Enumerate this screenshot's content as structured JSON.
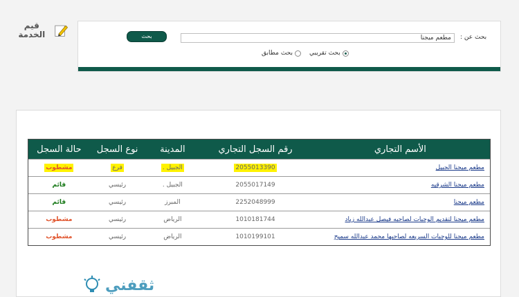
{
  "rating": {
    "label": "قيم الخدمة"
  },
  "search": {
    "button_label": "بحث",
    "search_by_label": "بحث عن :",
    "input_value": "مطعم ميجنا",
    "options": [
      {
        "label": "بحث تقريبي",
        "selected": true
      },
      {
        "label": "بحث مطابق",
        "selected": false
      }
    ]
  },
  "table": {
    "headers": {
      "name": "الأسم التجاري",
      "reg_no": "رقم السجل التجاري",
      "city": "المدينة",
      "type": "نوع السجل",
      "status": "حالة السجل"
    },
    "rows": [
      {
        "name": "مطعم ميجنا الجبيل",
        "reg_no": "2055013390",
        "city": "الجبيل .",
        "type": "فرع",
        "status": "مشطوب"
      },
      {
        "name": "مطعم ميجنا الشرقيه",
        "reg_no": "2055017149",
        "city": "الجبيل .",
        "type": "رئيسي",
        "status": "قائم"
      },
      {
        "name": "مطعم ميجنا",
        "reg_no": "2252048999",
        "city": "المبرز",
        "type": "رئيسي",
        "status": "قائم"
      },
      {
        "name": "مطعم ميجنا لتقديم الوجبات لصاحبه فيصل عبدالله زياد",
        "reg_no": "1010181744",
        "city": "الرياض",
        "type": "رئيسي",
        "status": "مشطوب"
      },
      {
        "name": "مطعم ميجنا للوجبات السريعه لصاحبها محمد عبدالله سميح",
        "reg_no": "1010199101",
        "city": "الرياض",
        "type": "رئيسي",
        "status": "مشطوب"
      }
    ]
  },
  "watermark": {
    "text": "ثقفني"
  },
  "colors": {
    "accent": "#0f5a4a",
    "active": "#1a7a1a",
    "struck": "#e0522a",
    "highlight": "#fff200"
  }
}
